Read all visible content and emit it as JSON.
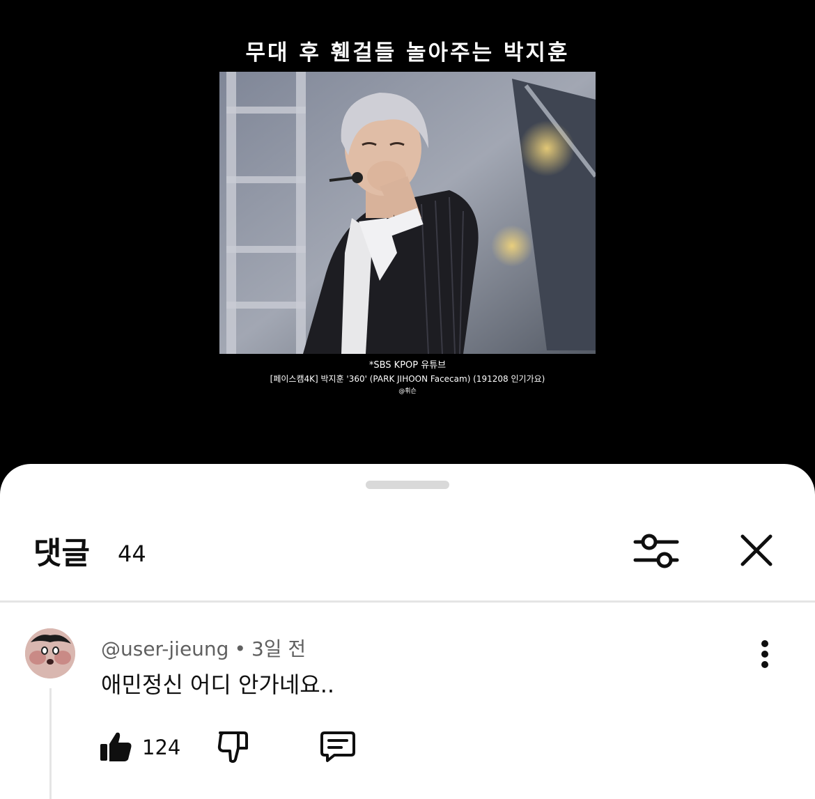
{
  "video": {
    "caption": "무대 후 휀걸들 놀아주는 박지훈",
    "credit_line1": "*SBS KPOP 유튜브",
    "credit_line2": "[페이스캠4K] 박지훈 '360' (PARK JIHOON Facecam) (191208 인기가요)",
    "credit_line3": "@휘슨"
  },
  "comments_panel": {
    "title": "댓글",
    "count": "44",
    "filter_icon": "sliders-icon",
    "close_icon": "close-icon"
  },
  "comments": [
    {
      "author": "@user-jieung",
      "separator": "•",
      "time": "3일 전",
      "text": "애민정신 어디 안가네요..",
      "likes": "124",
      "icons": [
        "thumbs-up-icon",
        "thumbs-down-icon",
        "reply-icon",
        "more-vert-icon"
      ]
    }
  ],
  "colors": {
    "background_top": "#000000",
    "sheet": "#ffffff",
    "text_primary": "#0f0f0f",
    "text_secondary": "#606060",
    "divider": "#e5e5e5"
  }
}
